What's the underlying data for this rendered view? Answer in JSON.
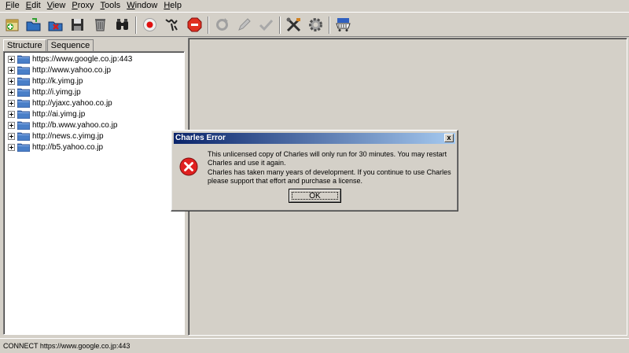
{
  "menu": [
    "File",
    "Edit",
    "View",
    "Proxy",
    "Tools",
    "Window",
    "Help"
  ],
  "toolbar": {
    "icons": [
      "new-session-icon",
      "open-icon",
      "close-session-icon",
      "save-icon",
      "clear-icon",
      "find-icon",
      "record-icon",
      "throttle-icon",
      "stop-icon",
      "repeat-icon",
      "edit-icon",
      "validate-icon",
      "tools-icon",
      "settings-icon",
      "shop-icon"
    ]
  },
  "tabs": [
    "Structure",
    "Sequence"
  ],
  "tree": {
    "items": [
      "https://www.google.co.jp:443",
      "http://www.yahoo.co.jp",
      "http://k.yimg.jp",
      "http://i.yimg.jp",
      "http://yjaxc.yahoo.co.jp",
      "http://ai.yimg.jp",
      "http://b.www.yahoo.co.jp",
      "http://news.c.yimg.jp",
      "http://b5.yahoo.co.jp"
    ]
  },
  "dialog": {
    "title": "Charles Error",
    "close": "x",
    "message1": "This unlicensed copy of Charles will only run for 30 minutes. You may restart Charles and use it again.",
    "message2": "Charles has taken many years of development. If you continue to use Charles please support that effort and purchase a license.",
    "ok": "OK"
  },
  "status": "CONNECT https://www.google.co.jp:443",
  "colors": {
    "titlebar_start": "#0a246a",
    "titlebar_end": "#a6caf0",
    "error_red": "#e02020",
    "folder_blue": "#4a7fc8"
  }
}
